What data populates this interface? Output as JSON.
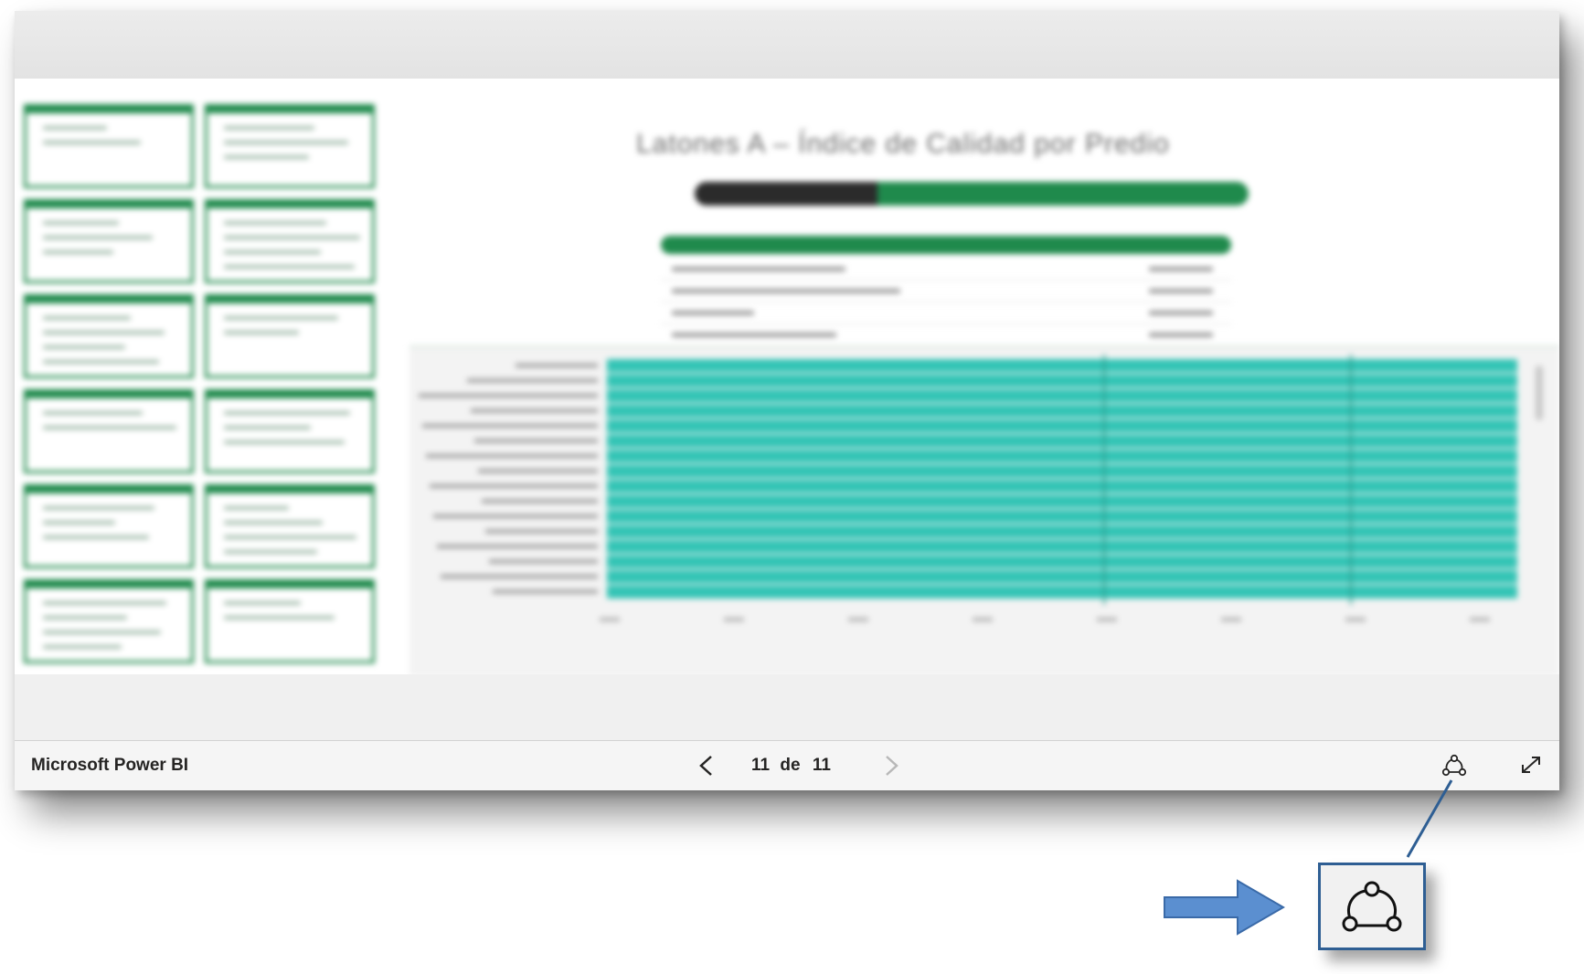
{
  "footer": {
    "brand": "Microsoft Power BI",
    "page_current": "11",
    "page_separator": "de",
    "page_total": "11"
  },
  "report": {
    "title": "Latones A – Índice de Calidad por Predio"
  },
  "icons": {
    "prev": "chevron-left-icon",
    "next": "chevron-right-icon",
    "share": "share-network-icon",
    "expand": "expand-icon"
  },
  "colors": {
    "accent_green": "#1f8a4c",
    "bar_teal": "#33c4b5",
    "callout_blue": "#2e5e93",
    "arrow_blue": "#5b8fd0"
  }
}
